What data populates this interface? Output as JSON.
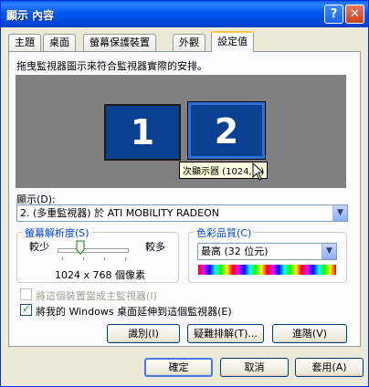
{
  "window": {
    "title": "顯示 內容",
    "help": "?",
    "close": "✕"
  },
  "tabs": [
    "主題",
    "桌面",
    "螢幕保護裝置",
    "外觀",
    "設定值"
  ],
  "instruction": "拖曳監視器圖示來符合監視器實際的安排。",
  "monitors": {
    "one": "1",
    "two": "2",
    "tooltip": "次顯示器 (1024, 0)"
  },
  "display": {
    "label": "顯示(D):",
    "value": "2. (多重監視器) 於 ATI MOBILITY RADEON"
  },
  "resolution": {
    "title": "螢幕解析度(S)",
    "less": "較少",
    "more": "較多",
    "value": "1024 x 768 個像素",
    "level": 0.33
  },
  "color_quality": {
    "title": "色彩品質(C)",
    "value": "最高 (32 位元)"
  },
  "checks": {
    "primary": {
      "label": "將這個裝置當成主監視器(I)",
      "checked": false
    },
    "extend": {
      "label": "將我的 Windows 桌面延伸到這個監視器(E)",
      "checked": true
    }
  },
  "buttons": {
    "identify": "識別(I)",
    "troubleshoot": "疑難排解(T)...",
    "advanced": "進階(V)",
    "ok": "確定",
    "cancel": "取消",
    "apply": "套用(A)"
  },
  "colors": {
    "title_bar": "#0058ee",
    "group_title": "#0046d5",
    "monitor": "#0b3f8f"
  }
}
